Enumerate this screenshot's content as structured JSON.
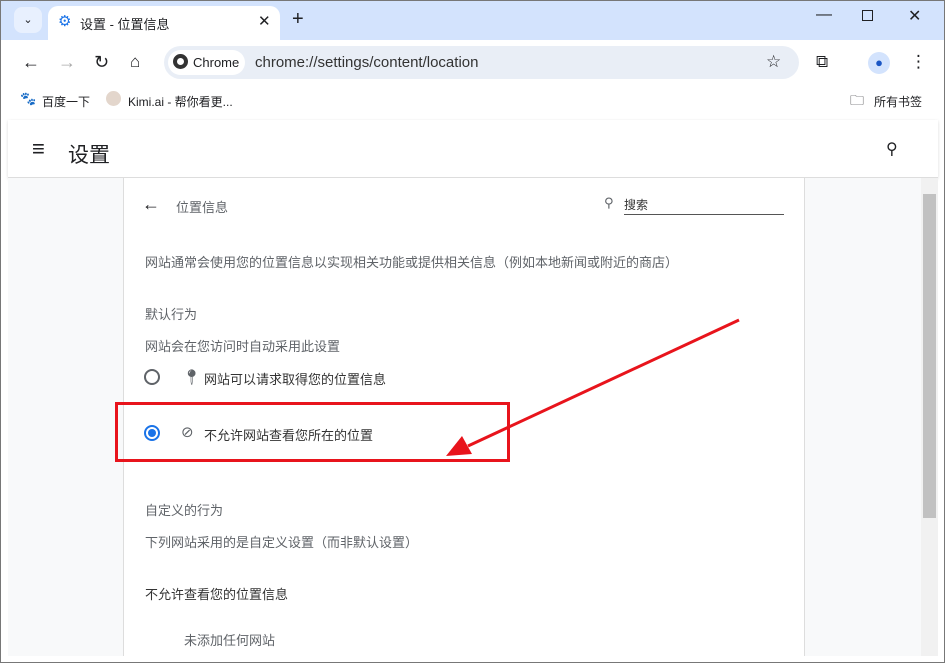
{
  "browser": {
    "tab_title": "设置 - 位置信息",
    "chip": "Chrome",
    "url": "chrome://settings/content/location",
    "bookmarks": [
      {
        "label": "百度一下"
      },
      {
        "label": "Kimi.ai - 帮你看更..."
      }
    ],
    "all_bookmarks": "所有书签"
  },
  "header": {
    "title": "设置"
  },
  "page": {
    "title": "位置信息",
    "search_placeholder": "搜索",
    "description": "网站通常会使用您的位置信息以实现相关功能或提供相关信息（例如本地新闻或附近的商店）",
    "default_heading": "默认行为",
    "default_sub": "网站会在您访问时自动采用此设置",
    "options": [
      {
        "label": "网站可以请求取得您的位置信息",
        "selected": false
      },
      {
        "label": "不允许网站查看您所在的位置",
        "selected": true
      }
    ],
    "custom_heading": "自定义的行为",
    "custom_sub": "下列网站采用的是自定义设置（而非默认设置）",
    "blocked_heading": "不允许查看您的位置信息",
    "blocked_empty": "未添加任何网站"
  },
  "annotation_color": "#e8141c",
  "accent": "#1a73e8"
}
